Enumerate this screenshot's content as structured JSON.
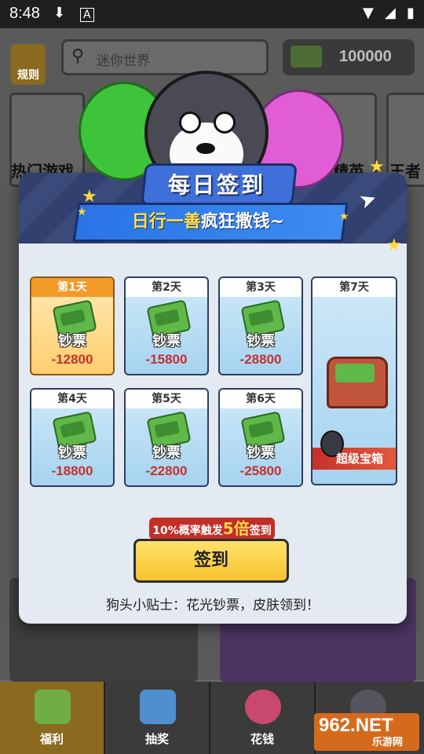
{
  "status_bar": {
    "time": "8:48",
    "icons": [
      "download-icon",
      "font-icon",
      "wifi-icon",
      "signal-icon",
      "battery-icon"
    ]
  },
  "header": {
    "rules_label": "规则",
    "search_placeholder": "迷你世界",
    "coins": "100000"
  },
  "categories": [
    "热门游戏",
    "精英",
    "王者"
  ],
  "dialog": {
    "title": "每日签到",
    "subtitle_a": "日行一善",
    "subtitle_b": "疯狂撒钱~",
    "days": [
      {
        "label": "第1天",
        "reward": "钞票",
        "amount": "-12800",
        "active": true
      },
      {
        "label": "第2天",
        "reward": "钞票",
        "amount": "-15800"
      },
      {
        "label": "第3天",
        "reward": "钞票",
        "amount": "-28800"
      },
      {
        "label": "第4天",
        "reward": "钞票",
        "amount": "-18800"
      },
      {
        "label": "第5天",
        "reward": "钞票",
        "amount": "-22800"
      },
      {
        "label": "第6天",
        "reward": "钞票",
        "amount": "-25800"
      }
    ],
    "day7": {
      "label": "第7天",
      "reward": "超级宝箱"
    },
    "bonus": {
      "prefix": "10%",
      "mid": "概率触发",
      "big": "5倍",
      "suffix": "签到"
    },
    "signin_button": "签到",
    "tip": "狗头小贴士：花光钞票，皮肤领到！"
  },
  "bottom_nav": [
    {
      "label": "福利",
      "active": true
    },
    {
      "label": "抽奖"
    },
    {
      "label": "花钱"
    },
    {
      "label": ""
    }
  ],
  "watermark": {
    "brand": "962.NET",
    "sub": "乐游网"
  },
  "colors": {
    "accent": "#f6c22e",
    "dialog_bg": "#e3eaf2",
    "amount": "#c8302c",
    "active_day": "#f39a27",
    "banner": "#3f6fd8"
  }
}
